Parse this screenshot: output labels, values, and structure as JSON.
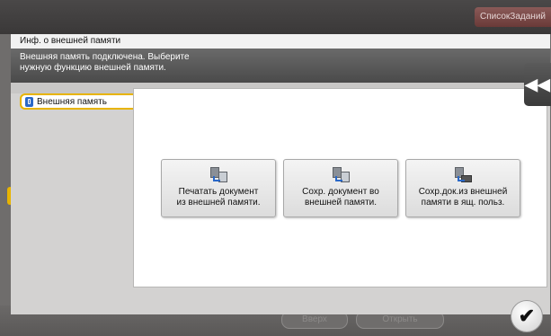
{
  "header": {
    "job_list_label": "СписокЗаданий"
  },
  "background": {
    "btn_left_label": "Вверх",
    "btn_right_label": "Открыть"
  },
  "dialog": {
    "title": "Инф. о внешней памяти",
    "message_line1": "Внешняя память подключена. Выберите",
    "message_line2": "нужную функцию внешней памяти.",
    "left_tab_label": "Внешняя память",
    "functions": [
      {
        "line1": "Печатать документ",
        "line2": "из внешней памяти.",
        "icon": "print-from-usb-icon"
      },
      {
        "line1": "Сохр. документ во",
        "line2": "внешней памяти.",
        "icon": "save-to-usb-icon"
      },
      {
        "line1": "Сохр.док.из внешней",
        "line2": "памяти в ящ. польз.",
        "icon": "save-to-box-icon"
      }
    ]
  },
  "controls": {
    "collapse_label": "◀◀",
    "ok_label": "✔"
  },
  "colors": {
    "accent": "#e8b400",
    "usb": "#2a68c8"
  }
}
